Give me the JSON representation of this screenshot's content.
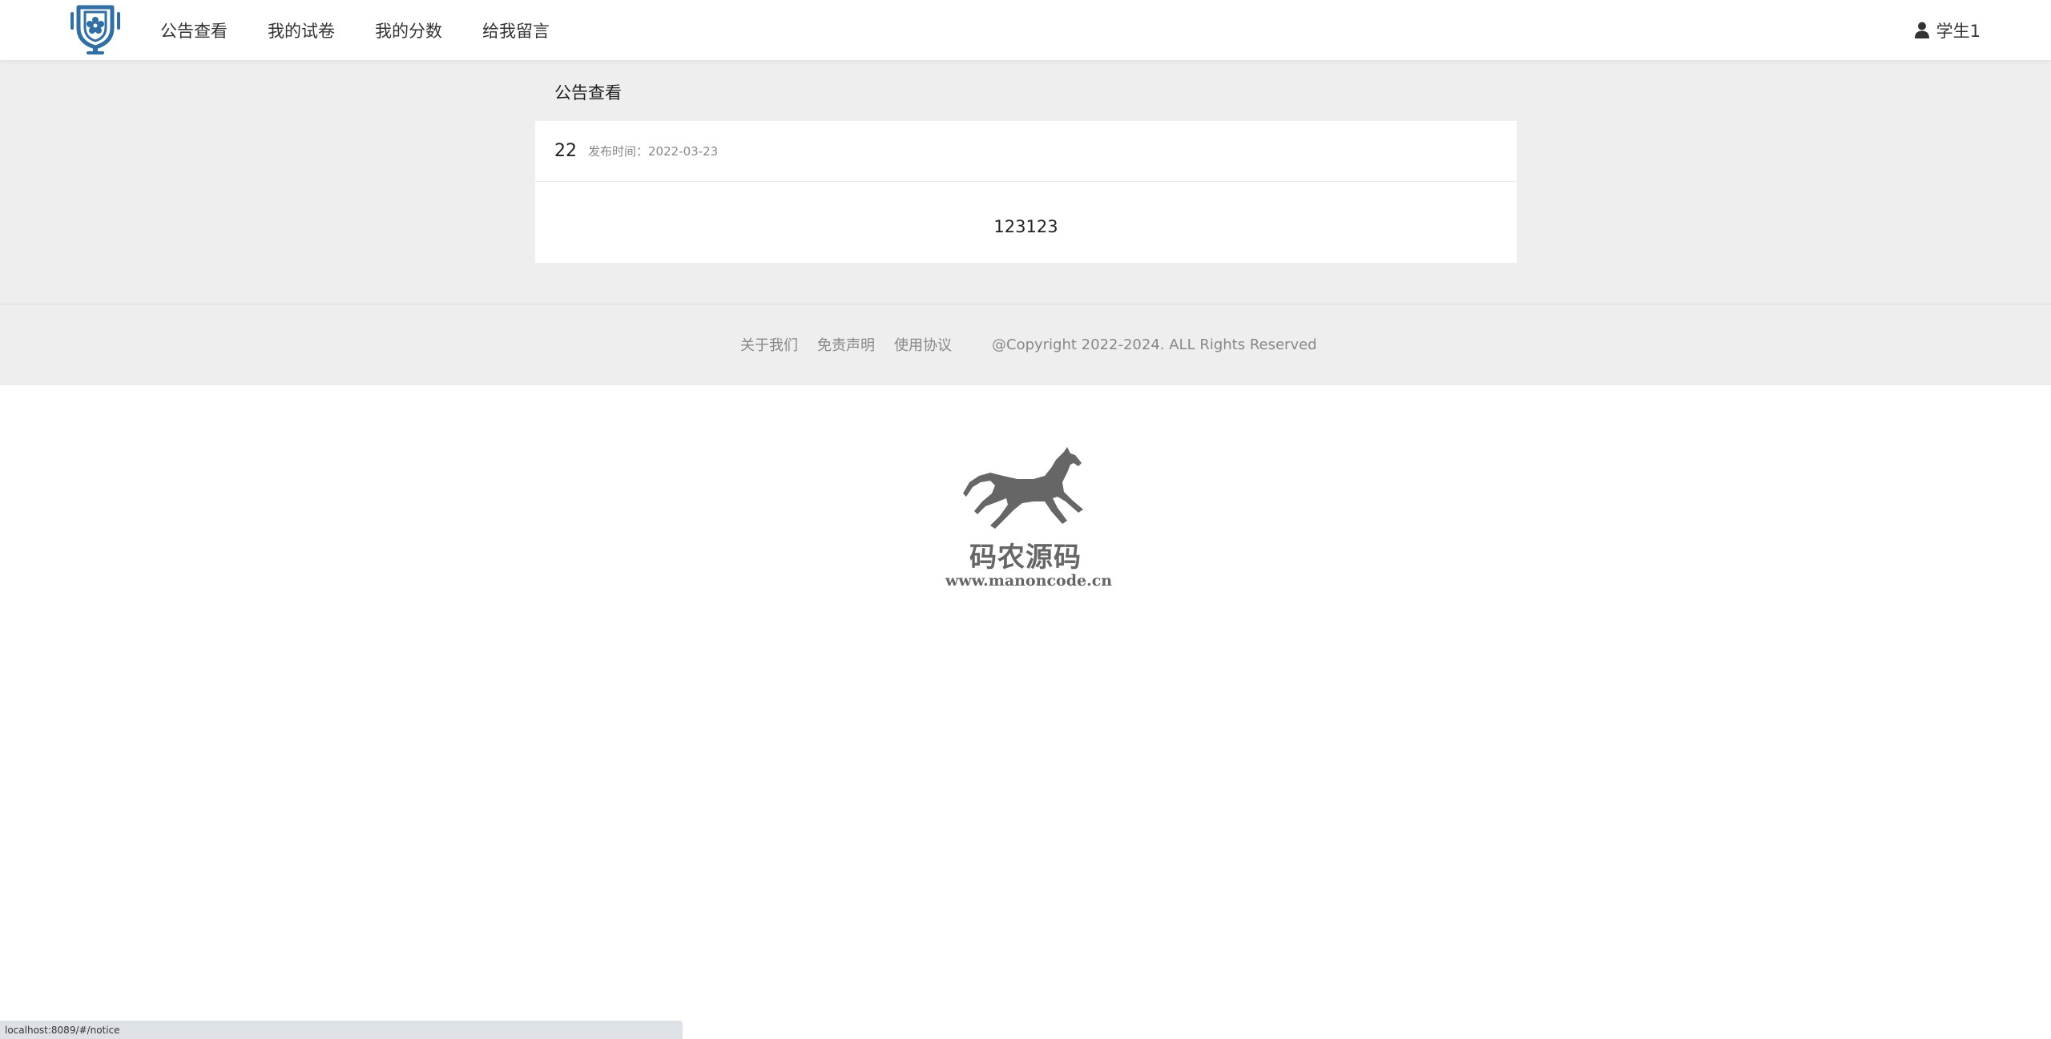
{
  "nav": {
    "items": [
      {
        "label": "公告查看"
      },
      {
        "label": "我的试卷"
      },
      {
        "label": "我的分数"
      },
      {
        "label": "给我留言"
      }
    ]
  },
  "user": {
    "icon": "user-icon",
    "name": "学生1"
  },
  "main": {
    "section_title": "公告查看",
    "notice": {
      "title": "22",
      "date_label": "发布时间：",
      "date": "2022-03-23",
      "content": "123123"
    }
  },
  "footer": {
    "links": [
      "关于我们",
      "免责声明",
      "使用协议"
    ],
    "copyright": "@Copyright 2022-2024. ALL Rights Reserved"
  },
  "watermark": {
    "name": "码农源码",
    "url": "www.manoncode.cn"
  },
  "statusbar": {
    "url": "localhost:8089/#/notice"
  },
  "colors": {
    "logo": "#2f6fa8",
    "background": "#eeeeee",
    "text": "#333333",
    "muted": "#888888"
  }
}
